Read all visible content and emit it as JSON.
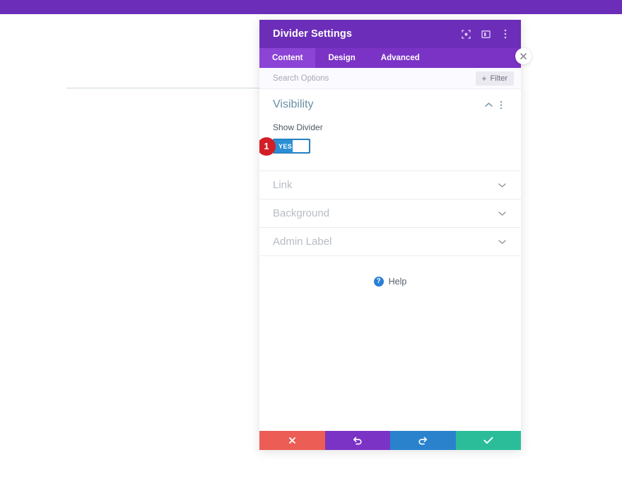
{
  "app": {
    "top_bar_color": "#6c2eb9",
    "accent_purple": "#7b33c6"
  },
  "canvas": {
    "divider_line_color": "#cfd9de"
  },
  "modal": {
    "title": "Divider Settings",
    "header_icons": [
      {
        "name": "focus-icon",
        "label": "Focus Mode"
      },
      {
        "name": "split-view-icon",
        "label": "Split View"
      },
      {
        "name": "more-options-icon",
        "label": "More Options"
      }
    ],
    "tabs": [
      {
        "label": "Content",
        "active": true
      },
      {
        "label": "Design",
        "active": false
      },
      {
        "label": "Advanced",
        "active": false
      }
    ],
    "search": {
      "value": "",
      "placeholder": "Search Options"
    },
    "filter": {
      "label": "Filter",
      "plus": "+"
    },
    "close_label": "✕"
  },
  "sections": {
    "open": {
      "title": "Visibility",
      "collapse_icon": "chevron-up-icon",
      "menu_icon": "more-options-icon",
      "field": {
        "label": "Show Divider",
        "toggle_value": "YES",
        "toggle_on": true,
        "badge": "1",
        "badge_color": "#d31e26"
      }
    },
    "collapsed": [
      {
        "title": "Link"
      },
      {
        "title": "Background"
      },
      {
        "title": "Admin Label"
      }
    ]
  },
  "help": {
    "label": "Help",
    "icon_glyph": "?"
  },
  "actions": [
    {
      "name": "cancel-button",
      "glyph": "close",
      "color": "#eb5d55"
    },
    {
      "name": "undo-button",
      "glyph": "undo",
      "color": "#7b33c6"
    },
    {
      "name": "redo-button",
      "glyph": "redo",
      "color": "#2a82cd"
    },
    {
      "name": "save-button",
      "glyph": "check",
      "color": "#2bbd9a"
    }
  ]
}
